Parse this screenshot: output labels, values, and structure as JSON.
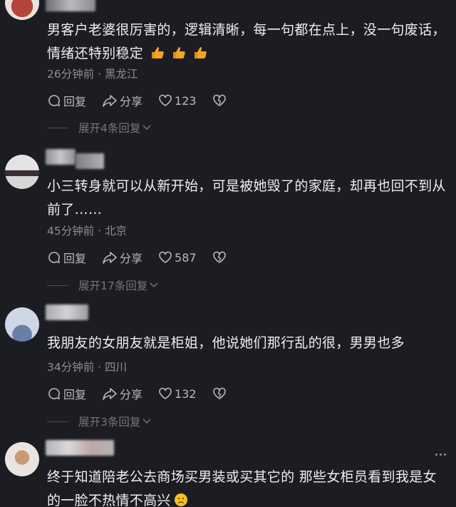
{
  "comments": [
    {
      "text": "男客户老婆很厉害的，逻辑清晰，每一句都在点上，没一句废话，情绪还特别稳定",
      "emoji": [
        "thumbs-up",
        "thumbs-up",
        "thumbs-up"
      ],
      "meta": "26分钟前 · 黑龙江",
      "reply_label": "回复",
      "share_label": "分享",
      "like_count": "123",
      "expand_label": "展开4条回复"
    },
    {
      "text": "小三转身就可以从新开始，可是被她毁了的家庭，却再也回不到从前了……",
      "meta": "45分钟前 · 北京",
      "reply_label": "回复",
      "share_label": "分享",
      "like_count": "587",
      "expand_label": "展开17条回复"
    },
    {
      "text": "我朋友的女朋友就是柜姐，他说她们那行乱的很，男男也多",
      "meta": "34分钟前 · 四川",
      "reply_label": "回复",
      "share_label": "分享",
      "like_count": "132",
      "expand_label": "展开3条回复"
    },
    {
      "text": "终于知道陪老公去商场买男装或买其它的  那些女柜员看到我是女的一脸不热情不高兴",
      "emoji": [
        "frown-face"
      ]
    }
  ],
  "colors": {
    "background": "#1c1d23",
    "text": "#eeeef0",
    "meta": "#8d8e94",
    "action": "#b8b9bf",
    "thumb": "#f3a522"
  }
}
